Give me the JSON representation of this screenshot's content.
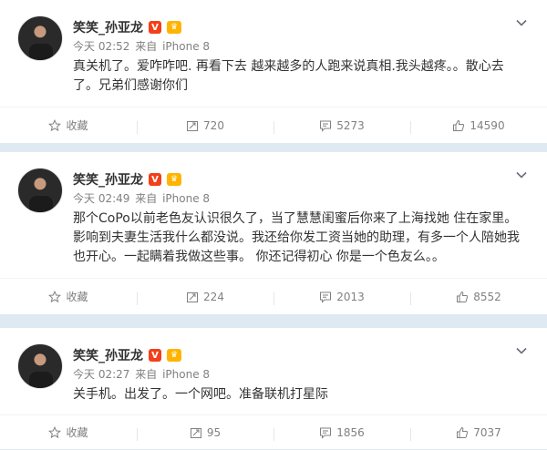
{
  "posts": [
    {
      "user": "笑笑_孙亚龙",
      "verified_badge": "V",
      "vip_badge": "♛",
      "time": "今天 02:52",
      "source_prefix": "来自",
      "source": "iPhone 8",
      "text": "真关机了。爱咋咋吧. 再看下去 越来越多的人跑来说真相.我头越疼。。散心去了。兄弟们感谢你们",
      "actions": {
        "favorite": "收藏",
        "repost": "720",
        "comment": "5273",
        "like": "14590"
      }
    },
    {
      "user": "笑笑_孙亚龙",
      "verified_badge": "V",
      "vip_badge": "♛",
      "time": "今天 02:49",
      "source_prefix": "来自",
      "source": "iPhone 8",
      "text": "那个CoPo以前老色友认识很久了，当了慧慧闺蜜后你来了上海找她 住在家里。影响到夫妻生活我什么都没说。我还给你发工资当她的助理，有多一个人陪她我也开心。一起瞒着我做这些事。 你还记得初心 你是一个色友么。。",
      "actions": {
        "favorite": "收藏",
        "repost": "224",
        "comment": "2013",
        "like": "8552"
      }
    },
    {
      "user": "笑笑_孙亚龙",
      "verified_badge": "V",
      "vip_badge": "♛",
      "time": "今天 02:27",
      "source_prefix": "来自",
      "source": "iPhone 8",
      "text": "关手机。出发了。一个网吧。准备联机打星际",
      "actions": {
        "favorite": "收藏",
        "repost": "95",
        "comment": "1856",
        "like": "7037"
      }
    }
  ]
}
